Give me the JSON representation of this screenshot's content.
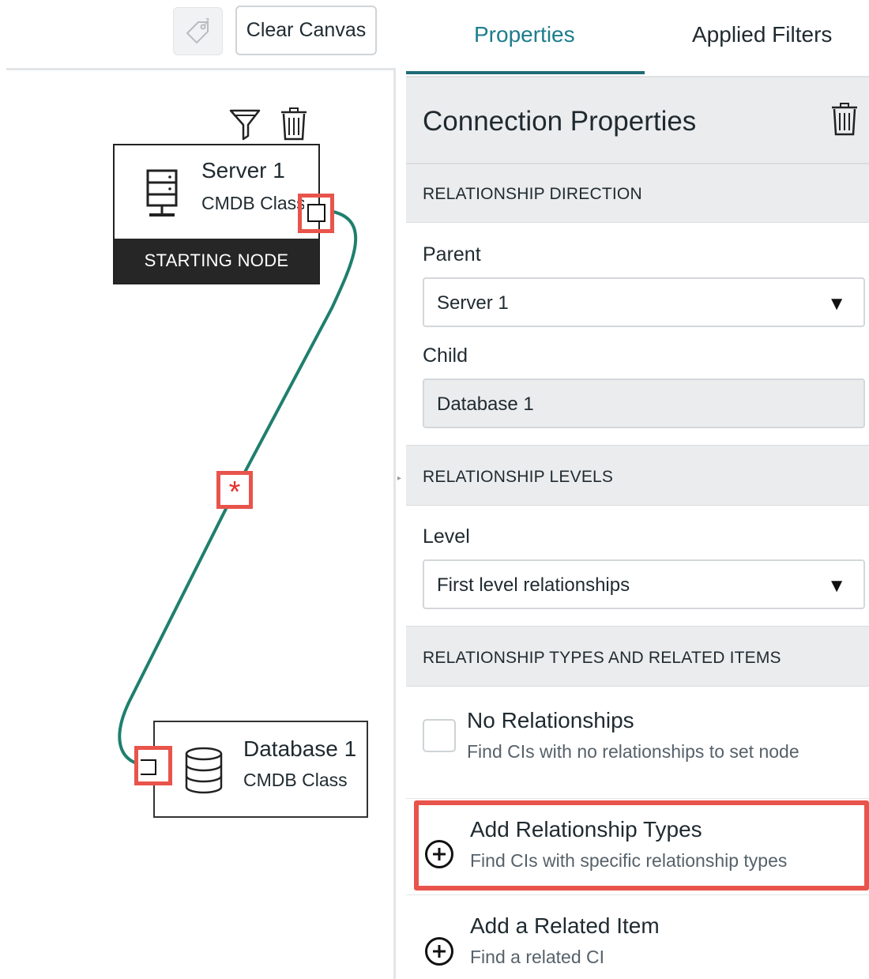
{
  "toolbar": {
    "tag_icon": "tag-icon",
    "clear_canvas_label": "Clear Canvas"
  },
  "canvas": {
    "tools": {
      "filter_icon": "filter-icon",
      "delete_icon": "trash-icon"
    },
    "server_node": {
      "title": "Server 1",
      "subtitle": "CMDB Class",
      "icon": "server-icon",
      "badge": "STARTING NODE"
    },
    "database_node": {
      "title": "Database 1",
      "subtitle": "CMDB Class",
      "icon": "database-icon"
    },
    "relationship_marker": "*",
    "connector_color": "#1f7f6e",
    "highlight_color": "#e8544b"
  },
  "panel": {
    "tabs": [
      {
        "label": "Properties",
        "active": true
      },
      {
        "label": "Applied Filters",
        "active": false
      }
    ],
    "title": "Connection Properties",
    "sections": {
      "direction": {
        "header": "RELATIONSHIP DIRECTION",
        "parent_label": "Parent",
        "parent_value": "Server 1",
        "child_label": "Child",
        "child_value": "Database 1"
      },
      "levels": {
        "header": "RELATIONSHIP LEVELS",
        "level_label": "Level",
        "level_value": "First level relationships"
      },
      "types": {
        "header": "RELATIONSHIP TYPES AND RELATED ITEMS",
        "options": [
          {
            "title": "No Relationships",
            "desc": "Find CIs with no relationships to set node",
            "checked": false
          },
          {
            "title": "Add Relationship Types",
            "desc": "Find CIs with specific relationship types"
          },
          {
            "title": "Add a Related Item",
            "desc": "Find a related CI"
          }
        ]
      }
    },
    "accent_color": "#1d7d8b"
  }
}
